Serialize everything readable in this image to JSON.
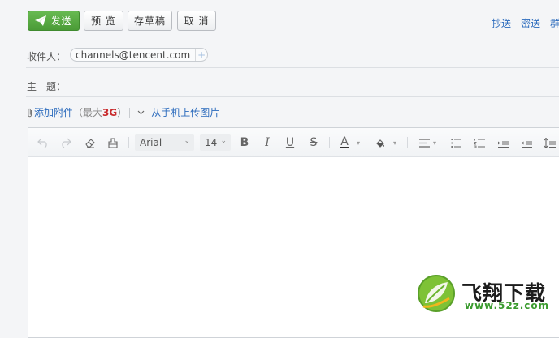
{
  "toolbar": {
    "send_label": "发送",
    "preview_label": "预 览",
    "draft_label": "存草稿",
    "cancel_label": "取 消"
  },
  "top_links": {
    "cc": "抄送",
    "bcc": "密送",
    "group": "群"
  },
  "recipient": {
    "label": "收件人：",
    "chip": "channels@tencent.com",
    "add": "+"
  },
  "subject": {
    "label": "主　题：",
    "value": ""
  },
  "attachments": {
    "add_label": "添加附件",
    "max_prefix": "（最大",
    "max_size": "3G",
    "max_suffix": "）",
    "mobile_upload": "从手机上传图片"
  },
  "editor": {
    "font_family": "Arial",
    "font_size": "14",
    "bold": "B",
    "italic": "I",
    "underline": "U",
    "strike": "S",
    "text_color": "A"
  },
  "watermark": {
    "name": "飞翔下载",
    "url": "www.52z.com"
  },
  "colors": {
    "send_green": "#4b9b37",
    "link_blue": "#2b6bbd",
    "size_red": "#c8292b"
  }
}
